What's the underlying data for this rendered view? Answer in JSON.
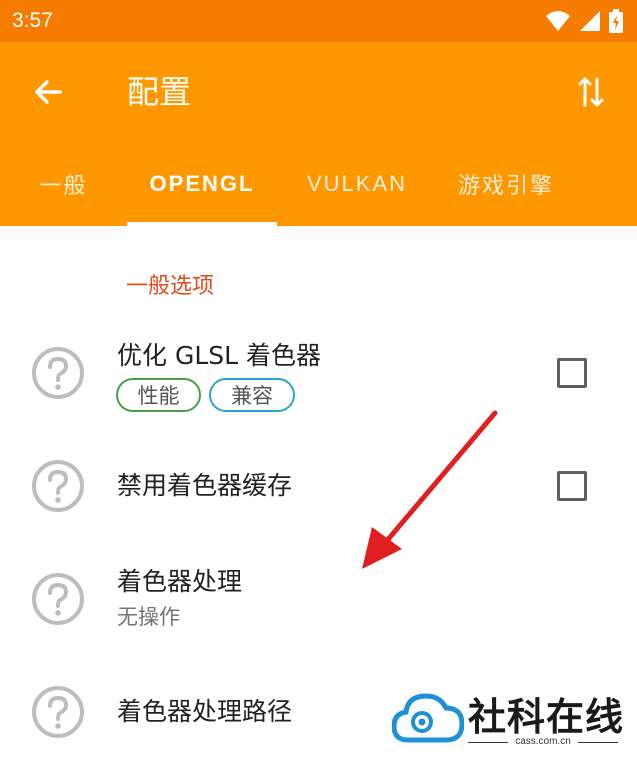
{
  "status_bar": {
    "time": "3:57"
  },
  "app_bar": {
    "title": "配置"
  },
  "tabs": [
    {
      "label": "一般"
    },
    {
      "label": "OPENGL",
      "active": true
    },
    {
      "label": "VULKAN"
    },
    {
      "label": "游戏引擎"
    }
  ],
  "section": {
    "header": "一般选项"
  },
  "preferences": [
    {
      "title": "优化 GLSL 着色器",
      "tags": [
        "性能",
        "兼容"
      ],
      "checked": false
    },
    {
      "title": "禁用着色器缓存",
      "checked": false
    },
    {
      "title": "着色器处理",
      "summary": "无操作"
    },
    {
      "title": "着色器处理路径"
    }
  ],
  "watermark": {
    "text": "社科在线",
    "sub": "cass.com.cn"
  },
  "colors": {
    "status_bar": "#f57c00",
    "app_bar": "#ff9800",
    "section_header": "#e64a19",
    "tag_performance": "#43a047",
    "tag_compat": "#29a3d6",
    "annotation_arrow": "#e02020"
  }
}
